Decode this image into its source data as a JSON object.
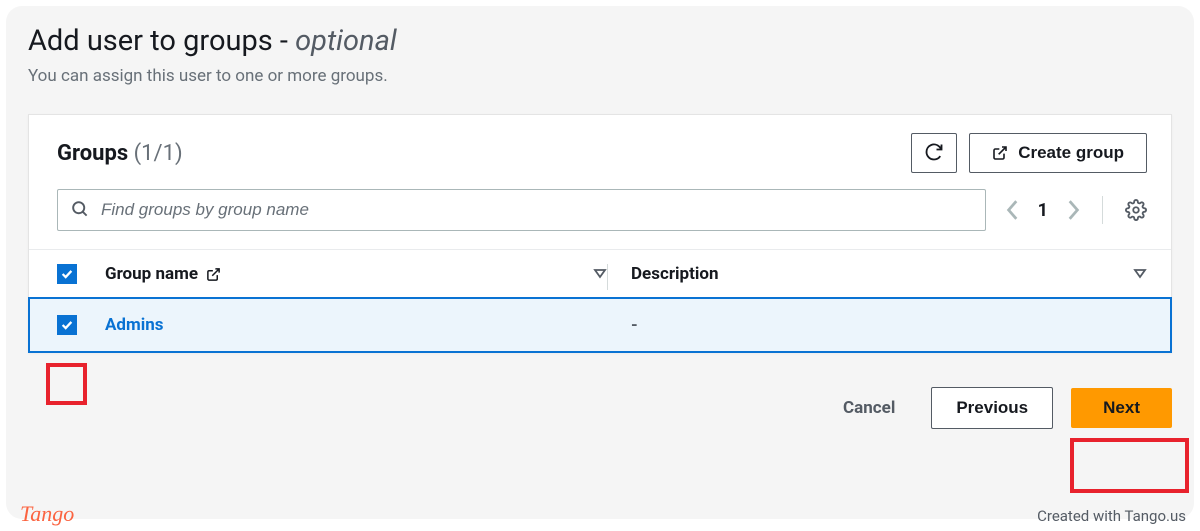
{
  "header": {
    "title_prefix": "Add user to groups - ",
    "title_optional": "optional",
    "subtitle": "You can assign this user to one or more groups."
  },
  "panel": {
    "title": "Groups",
    "count": "(1/1)",
    "create_button": "Create group",
    "search": {
      "placeholder": "Find groups by group name"
    },
    "pagination": {
      "page": "1"
    }
  },
  "columns": {
    "group_name": "Group name",
    "description": "Description"
  },
  "rows": [
    {
      "group_name": "Admins",
      "description": "-"
    }
  ],
  "footer": {
    "cancel": "Cancel",
    "previous": "Previous",
    "next": "Next"
  },
  "watermark": {
    "logo": "Tango",
    "text": "Created with Tango.us"
  }
}
